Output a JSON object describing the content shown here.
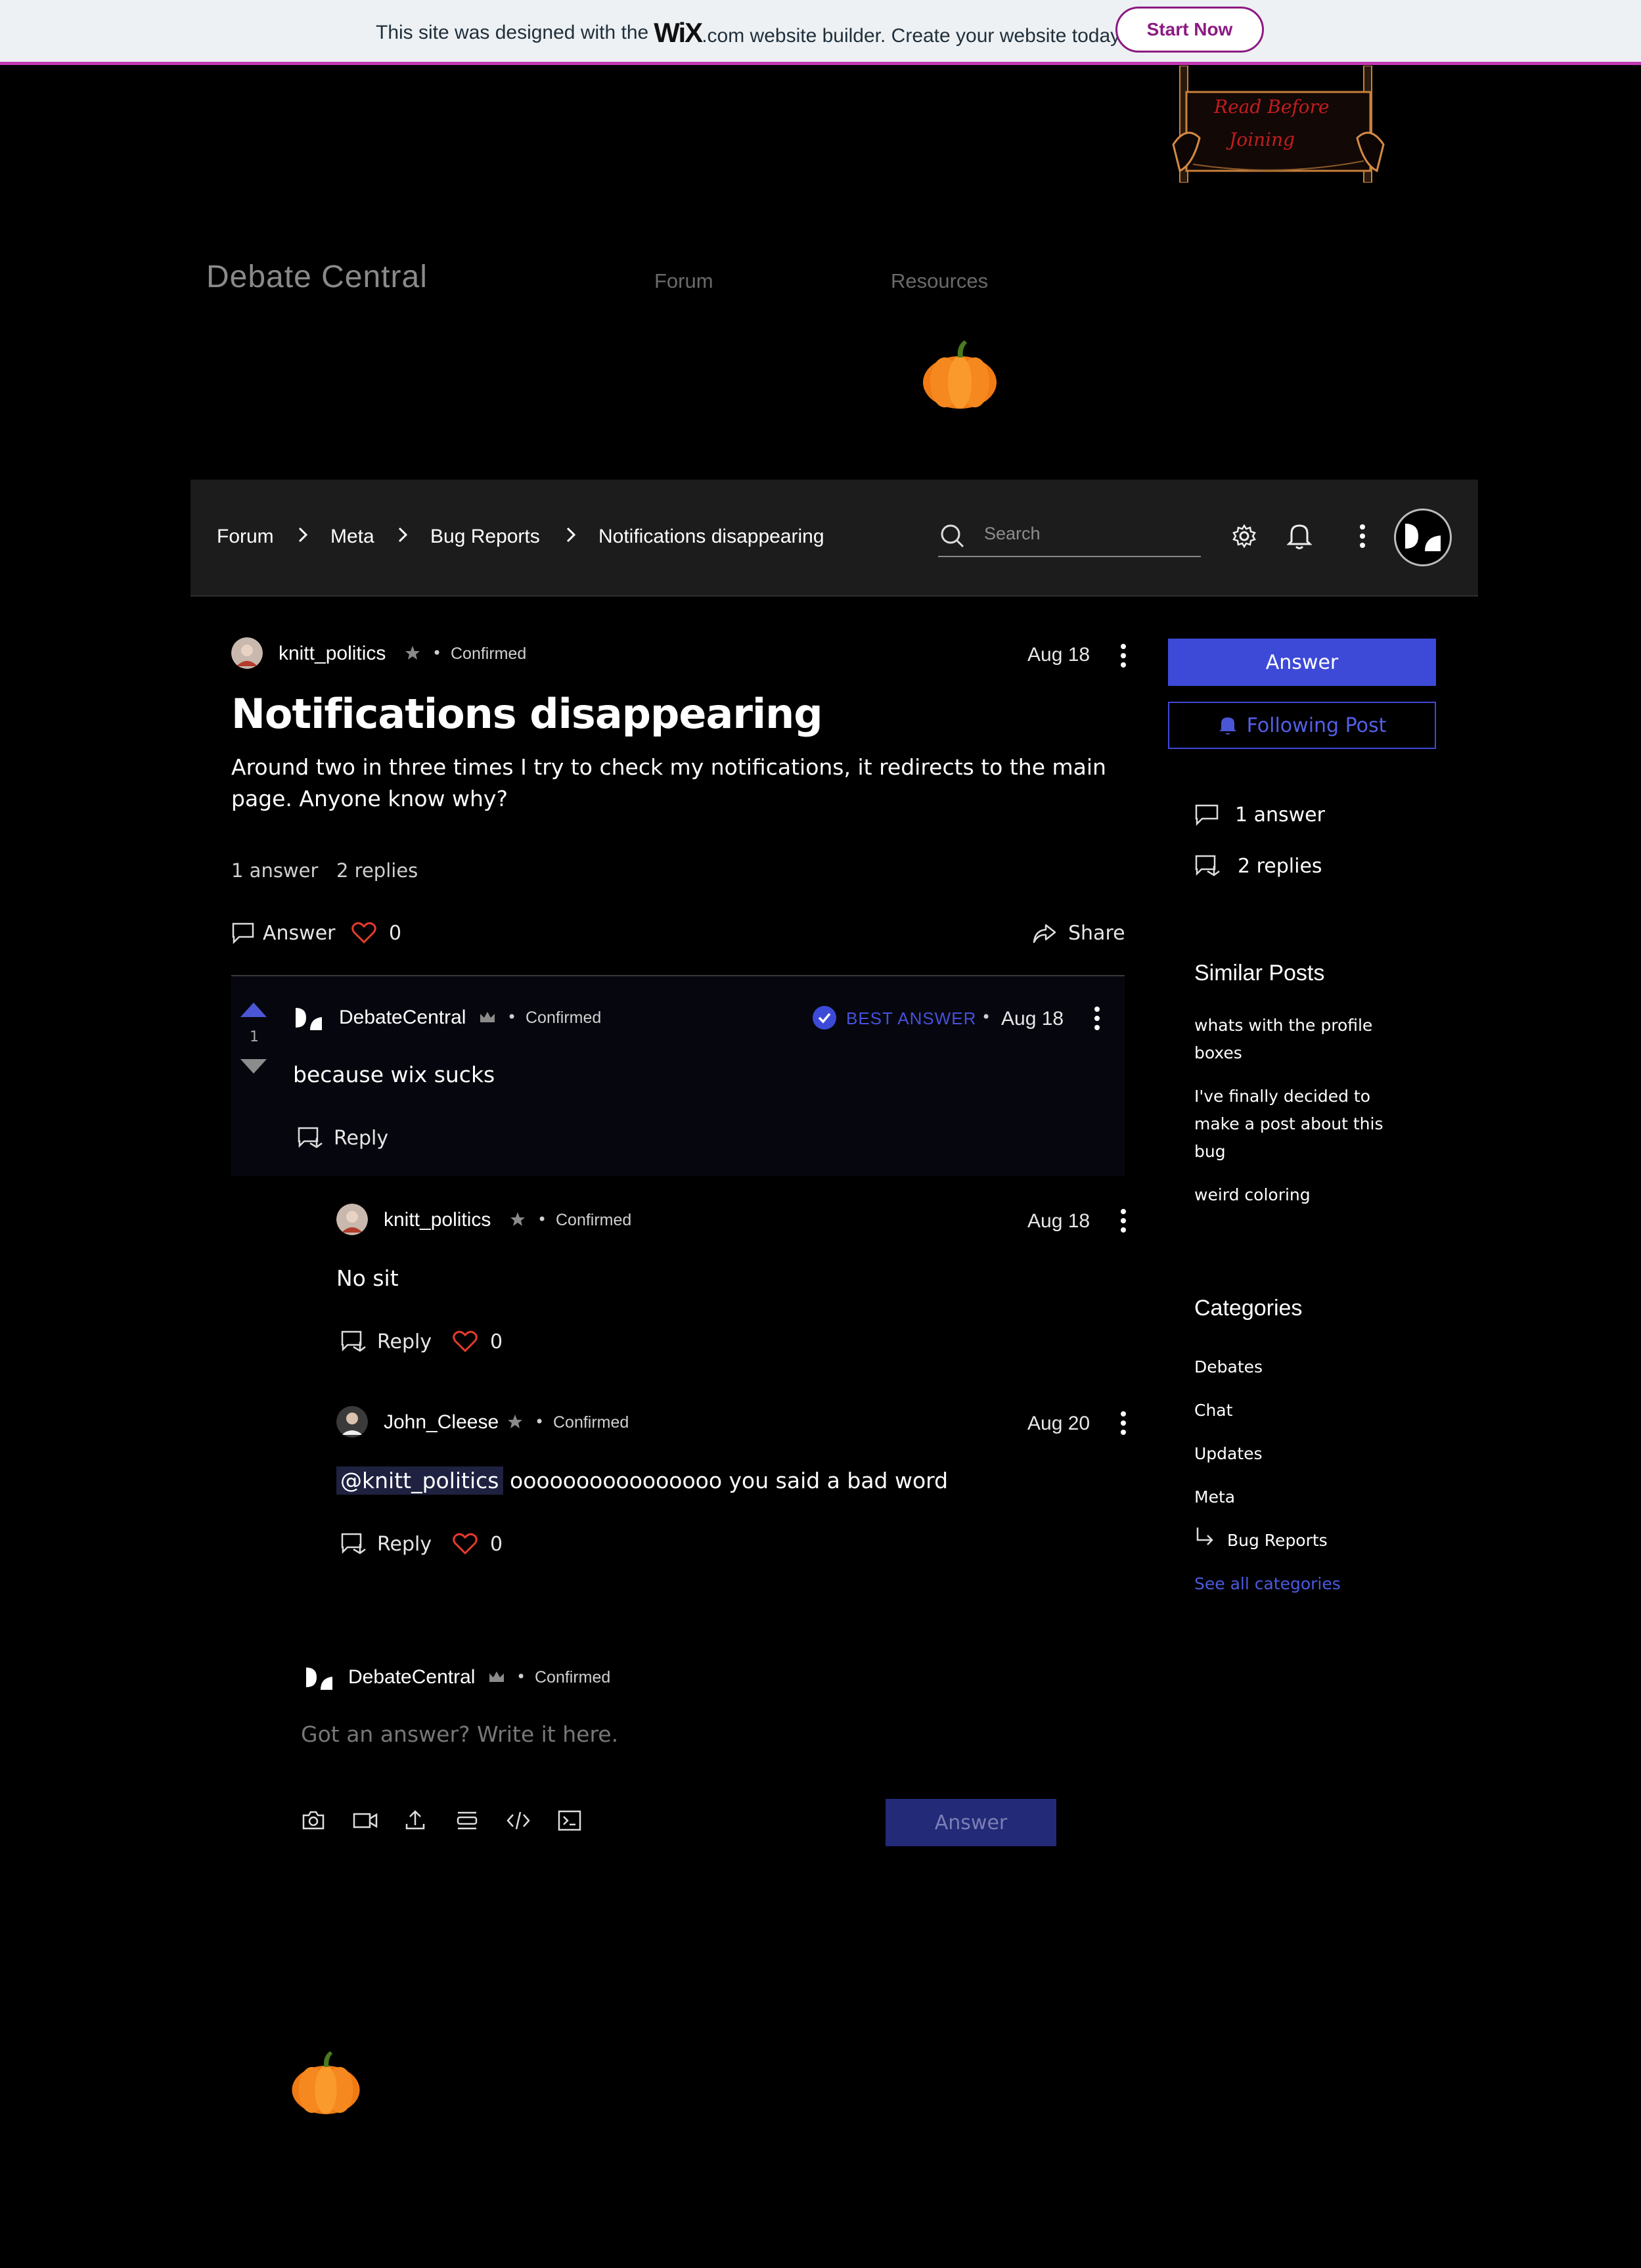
{
  "banner": {
    "text_before": "This site was designed with the",
    "logo": "WiX",
    "text_after": ".com website builder. Create your website today.",
    "cta": "Start Now"
  },
  "header": {
    "site_title": "Debate Central",
    "nav": [
      "Forum",
      "Resources"
    ],
    "sign_text": [
      "Read Before",
      "Joining"
    ]
  },
  "forum_bar": {
    "breadcrumbs": [
      "Forum",
      "Meta",
      "Bug Reports",
      "Notifications disappearing"
    ],
    "search_placeholder": "Search"
  },
  "post": {
    "author": "knitt_politics",
    "status": "Confirmed",
    "date": "Aug 18",
    "title": "Notifications disappearing",
    "body": "Around two in three times I try to check my notifications, it redirects to the main page.  Anyone know why?",
    "answers_count": "1 answer",
    "replies_count": "2 replies",
    "answer_label": "Answer",
    "like_count": "0",
    "share_label": "Share"
  },
  "best_answer": {
    "author": "DebateCentral",
    "status": "Confirmed",
    "badge": "BEST ANSWER",
    "date": "Aug 18",
    "votes": "1",
    "body": "because wix sucks",
    "reply_label": "Reply"
  },
  "replies": [
    {
      "author": "knitt_politics",
      "status": "Confirmed",
      "date": "Aug 18",
      "body": "No sit",
      "reply_label": "Reply",
      "likes": "0"
    },
    {
      "author": "John_Cleese",
      "status": "Confirmed",
      "date": "Aug 20",
      "mention": "@knitt_politics",
      "body": "oooooooooooooooo you said a bad word",
      "reply_label": "Reply",
      "likes": "0"
    }
  ],
  "composer": {
    "author": "DebateCentral",
    "status": "Confirmed",
    "placeholder": "Got an answer? Write it here.",
    "submit": "Answer",
    "tools": [
      "camera-icon",
      "video-icon",
      "upload-icon",
      "divider-icon",
      "code-icon",
      "terminal-icon"
    ]
  },
  "sidebar": {
    "answer_button": "Answer",
    "follow_button": "Following Post",
    "answers": "1 answer",
    "replies": "2 replies",
    "similar_heading": "Similar Posts",
    "similar_posts": [
      "whats with the profile boxes",
      "I've finally decided to make a post about this bug",
      "weird coloring"
    ],
    "categories_heading": "Categories",
    "categories": [
      "Debates",
      "Chat",
      "Updates",
      "Meta",
      "Bug Reports"
    ],
    "see_all": "See all categories"
  },
  "colors": {
    "accent": "#3d4ad8",
    "like": "#e53b2c",
    "wix_banner_border": "#c13bb4"
  }
}
